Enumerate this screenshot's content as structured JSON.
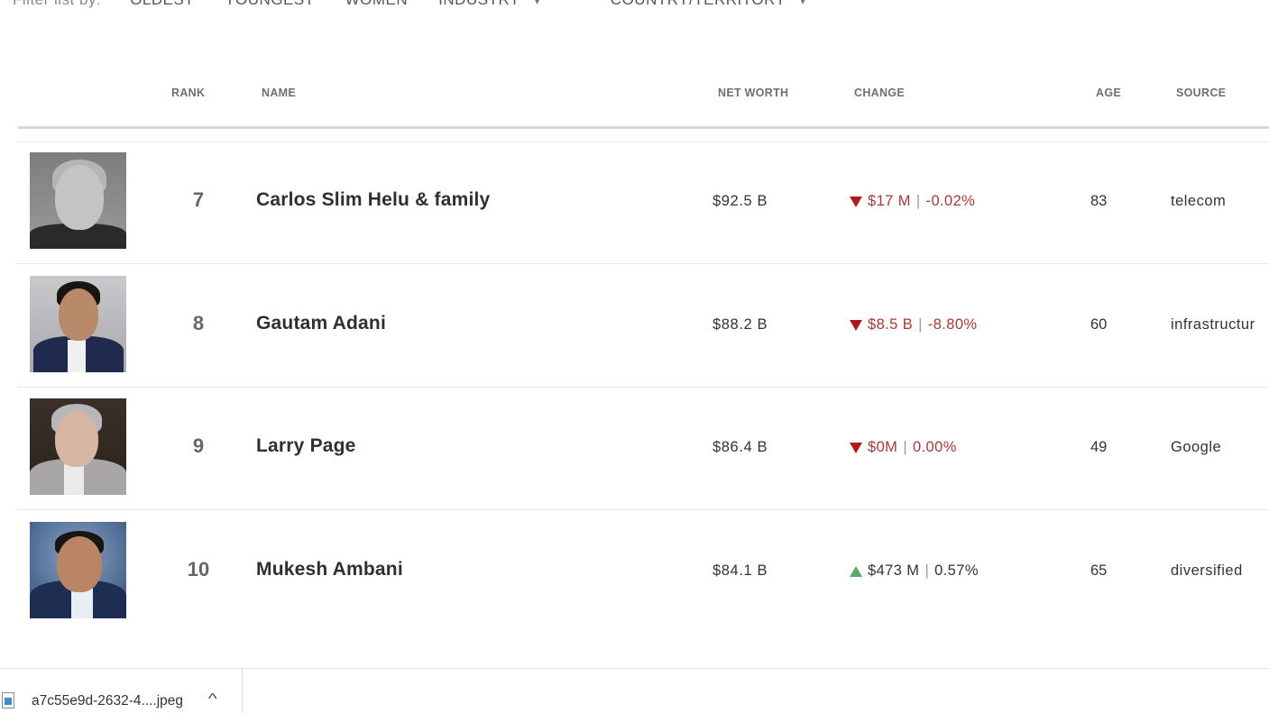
{
  "filter_bar": {
    "label": "Filter list by:",
    "options": [
      {
        "label": "OLDEST",
        "has_dropdown": false
      },
      {
        "label": "YOUNGEST",
        "has_dropdown": false
      },
      {
        "label": "WOMEN",
        "has_dropdown": false
      },
      {
        "label": "INDUSTRY",
        "has_dropdown": true
      },
      {
        "label": "COUNTRY/TERRITORY",
        "has_dropdown": true
      }
    ],
    "chevron_glyph": "▾"
  },
  "table": {
    "headers": {
      "rank": "RANK",
      "name": "NAME",
      "net_worth": "NET WORTH",
      "change": "CHANGE",
      "age": "AGE",
      "source": "SOURCE"
    },
    "rows": [
      {
        "rank": "7",
        "name": "Carlos Slim Helu & family",
        "net_worth": "$92.5 B",
        "change_direction": "down",
        "change_amount": "$17 M",
        "change_percent": "-0.02%",
        "age": "83",
        "source": "telecom"
      },
      {
        "rank": "8",
        "name": "Gautam Adani",
        "net_worth": "$88.2 B",
        "change_direction": "down",
        "change_amount": "$8.5 B",
        "change_percent": "-8.80%",
        "age": "60",
        "source": "infrastructur"
      },
      {
        "rank": "9",
        "name": "Larry Page",
        "net_worth": "$86.4 B",
        "change_direction": "down",
        "change_amount": "$0M",
        "change_percent": "0.00%",
        "age": "49",
        "source": "Google"
      },
      {
        "rank": "10",
        "name": "Mukesh Ambani",
        "net_worth": "$84.1 B",
        "change_direction": "up",
        "change_amount": "$473 M",
        "change_percent": "0.57%",
        "age": "65",
        "source": "diversified"
      }
    ],
    "separator": "|"
  },
  "colors": {
    "change_down_text": "#a33a3a",
    "change_down_arrow": "#b01a1a",
    "change_up_arrow": "#5aa86a"
  },
  "download_bar": {
    "file_name": "a7c55e9d-2632-4....jpeg",
    "file_icon": "image-file-icon",
    "chevron_glyph": "^"
  }
}
